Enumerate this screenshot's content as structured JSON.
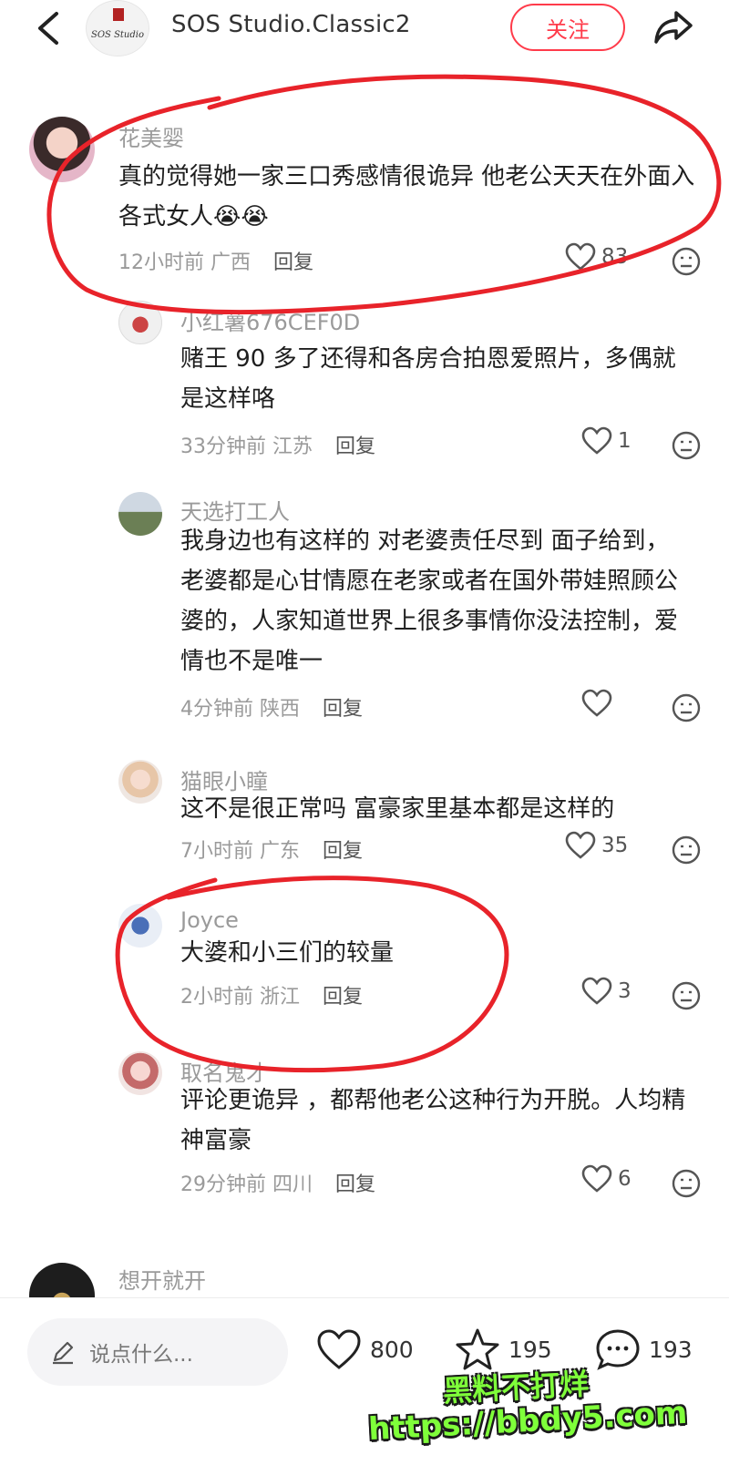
{
  "header": {
    "title": "SOS Studio.Classic2",
    "follow_label": "关注",
    "logo_text": "SOS Studio"
  },
  "comments": [
    {
      "name": "花美婴",
      "text": "真的觉得她一家三口秀感情很诡异 他老公天天在外面入各式女人😭😭",
      "time": "12小时前",
      "location": "广西",
      "reply": "回复",
      "likes": "83"
    },
    {
      "name": "小红薯676CEF0D",
      "text": "赌王 90 多了还得和各房合拍恩爱照片，多偶就是这样咯",
      "time": "33分钟前",
      "location": "江苏",
      "reply": "回复",
      "likes": "1"
    },
    {
      "name": "天选打工人",
      "text": "我身边也有这样的 对老婆责任尽到 面子给到，老婆都是心甘情愿在老家或者在国外带娃照顾公婆的，人家知道世界上很多事情你没法控制，爱情也不是唯一",
      "time": "4分钟前",
      "location": "陕西",
      "reply": "回复",
      "likes": ""
    },
    {
      "name": "猫眼小瞳",
      "text": "这不是很正常吗 富豪家里基本都是这样的",
      "time": "7小时前",
      "location": "广东",
      "reply": "回复",
      "likes": "35"
    },
    {
      "name": "Joyce",
      "text": "大婆和小三们的较量",
      "time": "2小时前",
      "location": "浙江",
      "reply": "回复",
      "likes": "3"
    },
    {
      "name": "取名鬼才",
      "text": "评论更诡异 ，都帮他老公这种行为开脱。人均精神富豪",
      "time": "29分钟前",
      "location": "四川",
      "reply": "回复",
      "likes": "6"
    },
    {
      "name": "想开就开"
    }
  ],
  "bottom_bar": {
    "input_placeholder": "说点什么...",
    "likes": "800",
    "stars": "195",
    "comments": "193"
  },
  "watermark": {
    "line1": "黑料不打烊",
    "line2": "https://bbdy5.com"
  },
  "colors": {
    "accent": "#ff3b4a",
    "annotation": "#e8232a",
    "watermark": "#7fff3a"
  }
}
